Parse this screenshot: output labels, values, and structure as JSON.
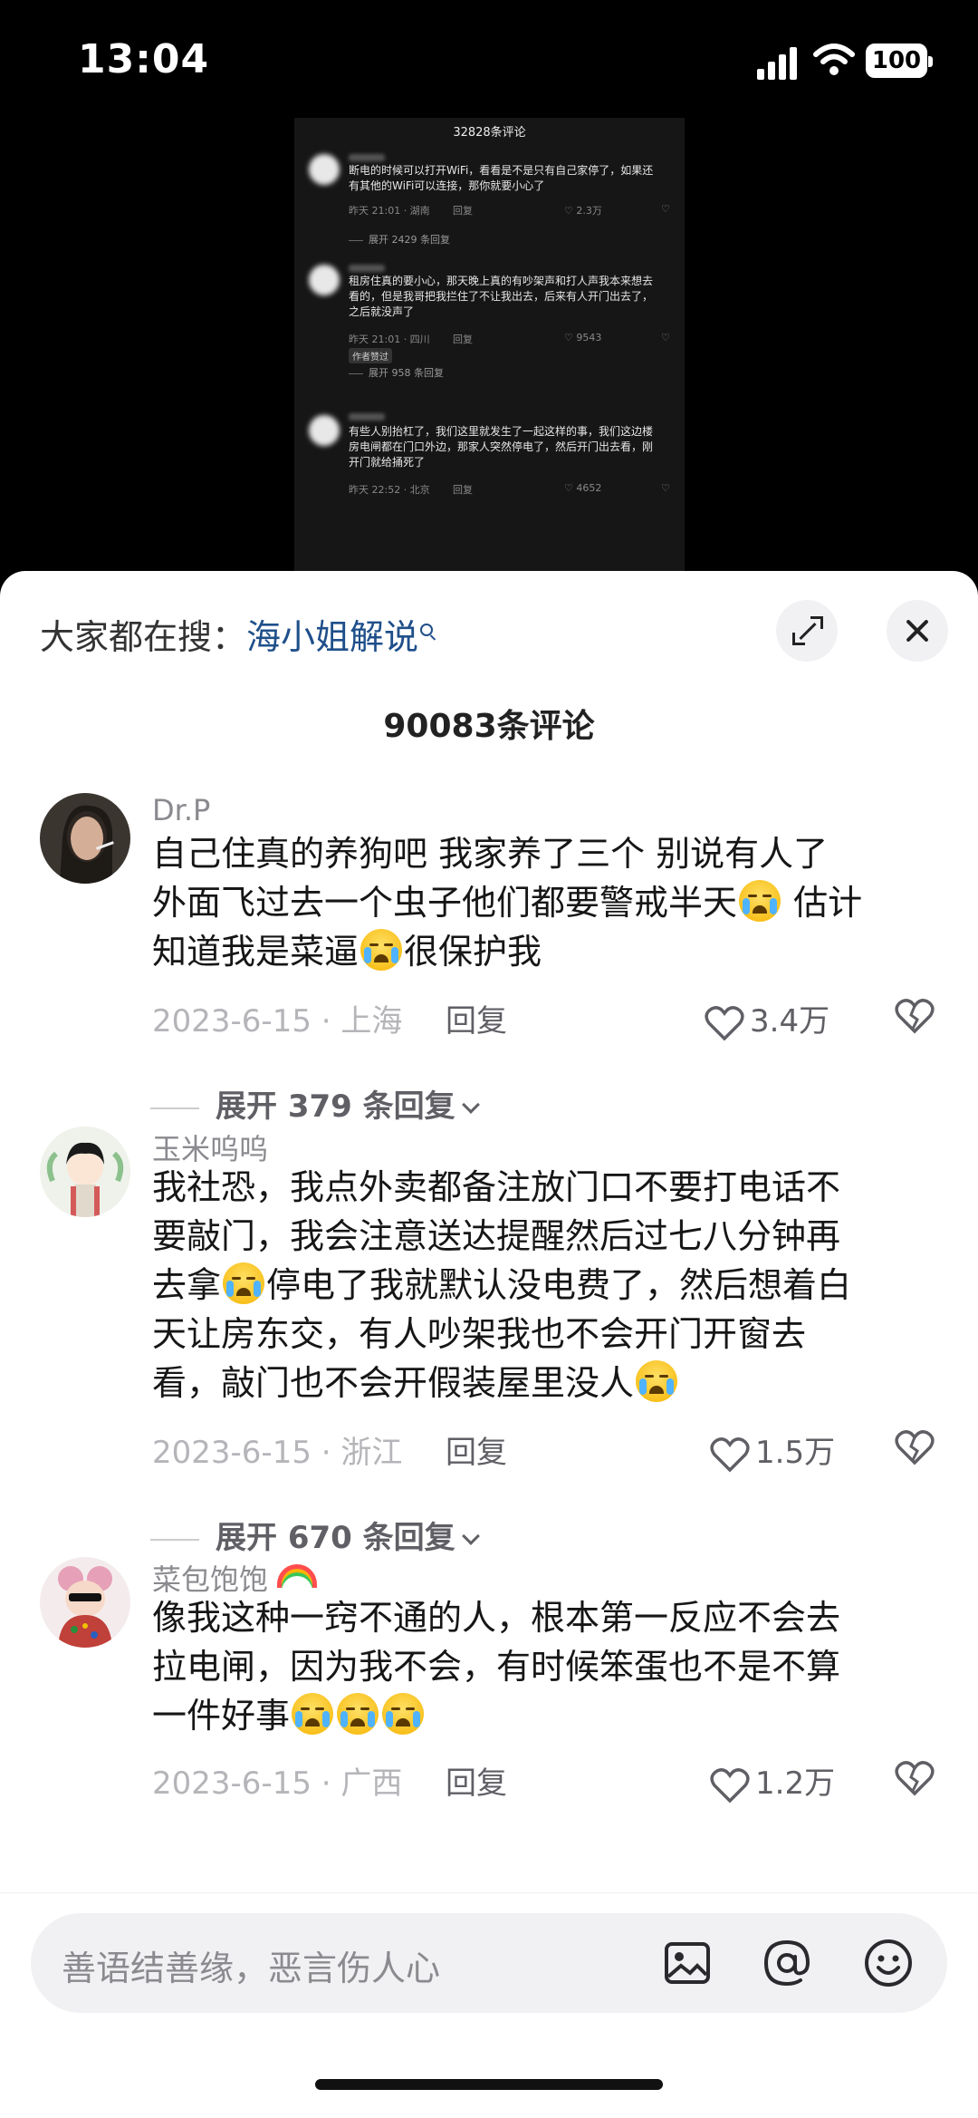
{
  "status": {
    "time": "13:04",
    "battery": "100"
  },
  "video": {
    "header": "32828条评论",
    "items": [
      {
        "text": "断电的时候可以打开WiFi，看看是不是只有自己家停了，如果还有其他的WiFi可以连接，那你就要小心了",
        "date": "昨天 21:01 · 湖南",
        "reply": "回复",
        "likes": "2.3万",
        "expand": "展开 2429 条回复"
      },
      {
        "text": "租房住真的要小心，那天晚上真的有吵架声和打人声我本来想去看的，但是我哥把我拦住了不让我出去，后来有人开门出去了，之后就没声了",
        "date": "昨天 21:01 · 四川",
        "reply": "回复",
        "likes": "9543",
        "tag": "作者赞过",
        "expand": "展开 958 条回复"
      },
      {
        "text": "有些人别抬杠了，我们这里就发生了一起这样的事，我们这边楼房电闸都在门口外边，那家人突然停电了，然后开门出去看，刚开门就给捅死了",
        "date": "昨天 22:52 · 北京",
        "reply": "回复",
        "likes": "4652"
      }
    ]
  },
  "search": {
    "prefix": "大家都在搜：",
    "keyword": "海小姐解说"
  },
  "comment_count": "90083条评论",
  "comments": [
    {
      "user": "Dr.P",
      "lines": [
        "自己住真的养狗吧 我家养了三个 别说有人了",
        "外面飞过去一个虫子他们都要警戒半天",
        "估计",
        "知道我是菜逼",
        "很保护我"
      ],
      "date": "2023-6-15 · 上海",
      "reply": "回复",
      "likes": "3.4万",
      "expand": "展开 379 条回复"
    },
    {
      "user": "玉米呜呜",
      "lines": [
        "我社恐，我点外卖都备注放门口不要打电话不",
        "要敲门，我会注意送达提醒然后过七八分钟再",
        "去拿",
        "停电了我就默认没电费了，然后想着白",
        "天让房东交，有人吵架我也不会开门开窗去",
        "看，敲门也不会开假装屋里没人"
      ],
      "date": "2023-6-15 · 浙江",
      "reply": "回复",
      "likes": "1.5万",
      "expand": "展开 670 条回复"
    },
    {
      "user": "菜包饱饱",
      "lines": [
        "像我这种一窍不通的人，根本第一反应不会去",
        "拉电闸，因为我不会，有时候笨蛋也不是不算",
        "一件好事"
      ],
      "date": "2023-6-15 · 广西",
      "reply": "回复",
      "likes": "1.2万"
    }
  ],
  "input": {
    "placeholder": "善语结善缘，恶言伤人心"
  },
  "icons": [
    "signal-icon",
    "wifi-icon",
    "battery-icon",
    "magnifier-icon",
    "expand-icon",
    "close-icon",
    "heart-icon",
    "dislike-icon",
    "chevron-down-icon",
    "crying-emoji-icon",
    "rainbow-emoji-icon",
    "image-icon",
    "at-icon",
    "emoji-icon"
  ]
}
